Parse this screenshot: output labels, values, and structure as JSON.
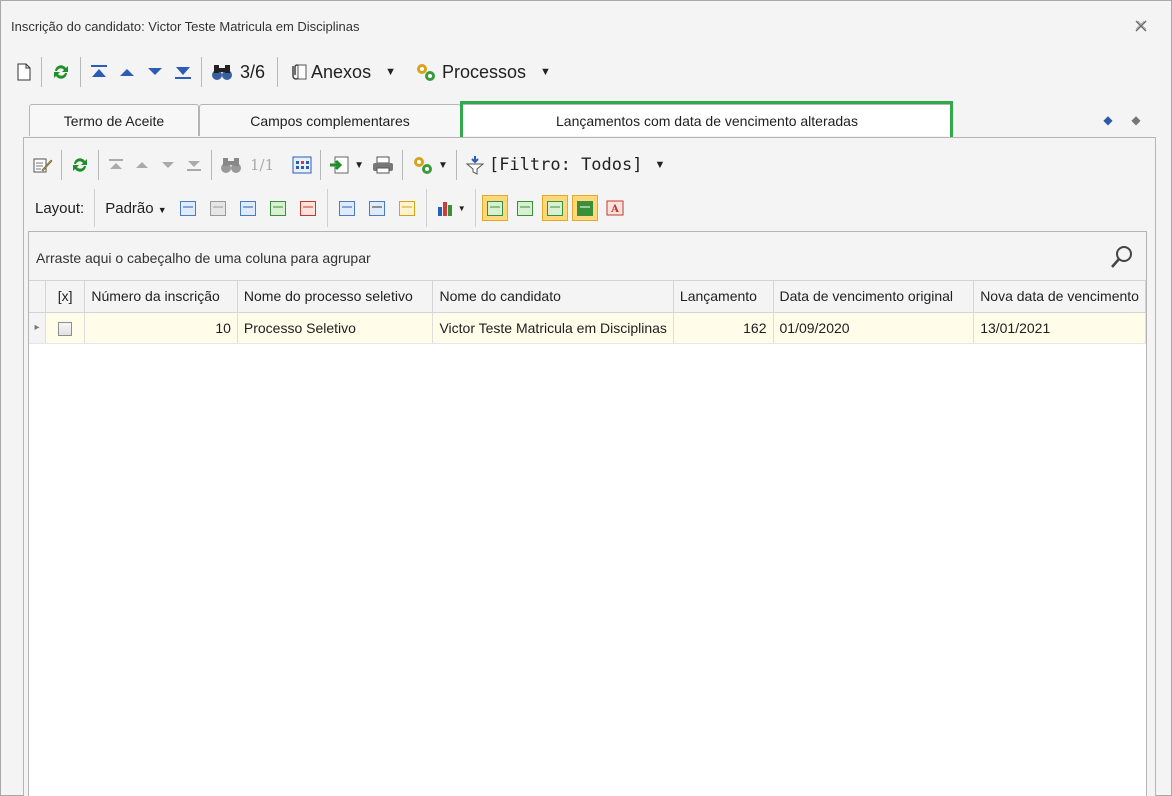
{
  "window": {
    "title": "Inscrição do candidato: Victor Teste Matricula em Disciplinas"
  },
  "main_toolbar": {
    "record_position": "3/6",
    "attachments_label": "Anexos",
    "processes_label": "Processos"
  },
  "tabs": [
    {
      "label": "Termo de Aceite",
      "active": false
    },
    {
      "label": "Campos complementares",
      "active": false
    },
    {
      "label": "Lançamentos com data de vencimento alteradas",
      "active": true
    }
  ],
  "sub_toolbar": {
    "record_position": "1/1",
    "filter_label": "[Filtro: Todos]"
  },
  "layout_bar": {
    "layout_label": "Layout:",
    "preset_label": "Padrão"
  },
  "grid": {
    "group_hint": "Arraste aqui o cabeçalho de uma coluna para agrupar",
    "columns": [
      "[x]",
      "Número da inscrição",
      "Nome do processo seletivo",
      "Nome do candidato",
      "Lançamento",
      "Data de vencimento original",
      "Nova data de vencimento"
    ],
    "rows": [
      {
        "checked": false,
        "inscricao": "10",
        "processo": "Processo Seletivo",
        "candidato": "Victor Teste Matricula em Disciplinas",
        "lancamento": "162",
        "vencimento_original": "01/09/2020",
        "nova_data": "13/01/2021"
      }
    ]
  },
  "colors": {
    "highlight": "#2fab4c",
    "row_background": "#fffde9",
    "toggle_on": "#ffd87a"
  }
}
